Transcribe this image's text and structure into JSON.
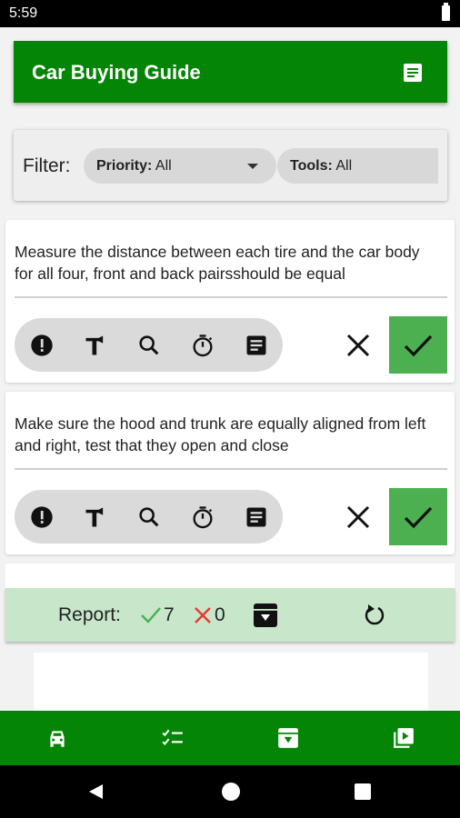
{
  "status_bar": {
    "time": "5:59"
  },
  "app_bar": {
    "title": "Car Buying Guide",
    "icon": "notes-icon"
  },
  "filter": {
    "label": "Filter:",
    "priority": {
      "key": "Priority:",
      "value": "All"
    },
    "tools": {
      "key": "Tools:",
      "value": "All"
    }
  },
  "tasks": [
    {
      "text": "Measure the distance between each tire and the car body for all four, front and back pairsshould be equal",
      "tool_icons": [
        "priority-icon",
        "hammer-icon",
        "search-icon",
        "timer-icon",
        "notes-icon"
      ]
    },
    {
      "text": "Make sure the hood and trunk are equally aligned from left and right, test that they open and close",
      "tool_icons": [
        "priority-icon",
        "hammer-icon",
        "search-icon",
        "timer-icon",
        "notes-icon"
      ]
    }
  ],
  "report": {
    "label": "Report:",
    "passed": "7",
    "failed": "0"
  },
  "colors": {
    "primary": "#058505",
    "accent_green": "#4caf50",
    "report_bg": "#c8e6c9",
    "fail_red": "#e53935"
  },
  "bottom_nav": [
    "car-icon",
    "checklist-icon",
    "archive-icon",
    "video-library-icon"
  ]
}
